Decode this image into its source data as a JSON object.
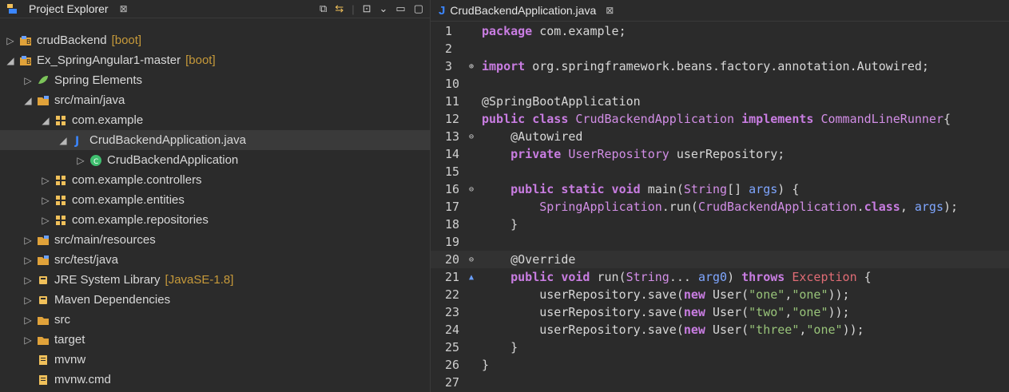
{
  "explorer": {
    "title": "Project Explorer",
    "close": "⊠",
    "items": [
      {
        "indent": 1,
        "toggle": "▷",
        "icon": "project-boot",
        "label": "crudBackend",
        "deco": "[boot]"
      },
      {
        "indent": 1,
        "toggle": "◢",
        "icon": "project-boot",
        "label": "Ex_SpringAngular1-master",
        "deco": "[boot]"
      },
      {
        "indent": 2,
        "toggle": "▷",
        "icon": "spring-leaf",
        "label": "Spring Elements",
        "deco": ""
      },
      {
        "indent": 2,
        "toggle": "◢",
        "icon": "source-folder",
        "label": "src/main/java",
        "deco": ""
      },
      {
        "indent": 3,
        "toggle": "◢",
        "icon": "package",
        "label": "com.example",
        "deco": ""
      },
      {
        "indent": 4,
        "toggle": "◢",
        "icon": "java-file",
        "label": "CrudBackendApplication.java",
        "deco": "",
        "selected": true
      },
      {
        "indent": 5,
        "toggle": "▷",
        "icon": "class",
        "label": "CrudBackendApplication",
        "deco": ""
      },
      {
        "indent": 3,
        "toggle": "▷",
        "icon": "package",
        "label": "com.example.controllers",
        "deco": ""
      },
      {
        "indent": 3,
        "toggle": "▷",
        "icon": "package",
        "label": "com.example.entities",
        "deco": ""
      },
      {
        "indent": 3,
        "toggle": "▷",
        "icon": "package",
        "label": "com.example.repositories",
        "deco": ""
      },
      {
        "indent": 2,
        "toggle": "▷",
        "icon": "source-folder",
        "label": "src/main/resources",
        "deco": ""
      },
      {
        "indent": 2,
        "toggle": "▷",
        "icon": "source-folder",
        "label": "src/test/java",
        "deco": ""
      },
      {
        "indent": 2,
        "toggle": "▷",
        "icon": "library",
        "label": "JRE System Library",
        "deco": "[JavaSE-1.8]"
      },
      {
        "indent": 2,
        "toggle": "▷",
        "icon": "library",
        "label": "Maven Dependencies",
        "deco": ""
      },
      {
        "indent": 2,
        "toggle": "▷",
        "icon": "folder",
        "label": "src",
        "deco": ""
      },
      {
        "indent": 2,
        "toggle": "▷",
        "icon": "folder",
        "label": "target",
        "deco": ""
      },
      {
        "indent": 2,
        "toggle": "",
        "icon": "file",
        "label": "mvnw",
        "deco": ""
      },
      {
        "indent": 2,
        "toggle": "",
        "icon": "file",
        "label": "mvnw.cmd",
        "deco": ""
      }
    ]
  },
  "editor": {
    "tab": {
      "label": "CrudBackendApplication.java",
      "close": "⊠"
    },
    "lines": [
      {
        "n": "1",
        "m": "",
        "segments": [
          {
            "t": "package",
            "c": "kw"
          },
          {
            "t": " com.example;",
            "c": "plain"
          }
        ]
      },
      {
        "n": "2",
        "m": "",
        "segments": []
      },
      {
        "n": "3",
        "m": "⊕",
        "segments": [
          {
            "t": "import",
            "c": "kw"
          },
          {
            "t": " org.springframework.beans.factory.annotation.Autowired;",
            "c": "plain"
          }
        ]
      },
      {
        "n": "10",
        "m": "",
        "segments": []
      },
      {
        "n": "11",
        "m": "",
        "segments": [
          {
            "t": "@SpringBootApplication",
            "c": "ann"
          }
        ]
      },
      {
        "n": "12",
        "m": "",
        "segments": [
          {
            "t": "public class ",
            "c": "kw"
          },
          {
            "t": "CrudBackendApplication",
            "c": "cls"
          },
          {
            "t": " implements ",
            "c": "kw"
          },
          {
            "t": "CommandLineRunner",
            "c": "cls"
          },
          {
            "t": "{",
            "c": "plain"
          }
        ]
      },
      {
        "n": "13",
        "m": "⊖",
        "segments": [
          {
            "t": "    @Autowired",
            "c": "ann"
          }
        ]
      },
      {
        "n": "14",
        "m": "",
        "segments": [
          {
            "t": "    private ",
            "c": "kw"
          },
          {
            "t": "UserRepository",
            "c": "cls"
          },
          {
            "t": " userRepository;",
            "c": "plain"
          }
        ]
      },
      {
        "n": "15",
        "m": "",
        "segments": []
      },
      {
        "n": "16",
        "m": "⊖",
        "segments": [
          {
            "t": "    public static void ",
            "c": "kw"
          },
          {
            "t": "main(",
            "c": "plain"
          },
          {
            "t": "String",
            "c": "cls"
          },
          {
            "t": "[] ",
            "c": "plain"
          },
          {
            "t": "args",
            "c": "pname"
          },
          {
            "t": ") {",
            "c": "plain"
          }
        ]
      },
      {
        "n": "17",
        "m": "",
        "segments": [
          {
            "t": "        ",
            "c": "plain"
          },
          {
            "t": "SpringApplication",
            "c": "cls"
          },
          {
            "t": ".run(",
            "c": "plain"
          },
          {
            "t": "CrudBackendApplication",
            "c": "cls"
          },
          {
            "t": ".",
            "c": "plain"
          },
          {
            "t": "class",
            "c": "kw"
          },
          {
            "t": ", ",
            "c": "plain"
          },
          {
            "t": "args",
            "c": "pname"
          },
          {
            "t": ");",
            "c": "plain"
          }
        ]
      },
      {
        "n": "18",
        "m": "",
        "segments": [
          {
            "t": "    }",
            "c": "plain"
          }
        ]
      },
      {
        "n": "19",
        "m": "",
        "segments": []
      },
      {
        "n": "20",
        "m": "⊖",
        "segments": [
          {
            "t": "    @Override",
            "c": "ann"
          }
        ],
        "current": true
      },
      {
        "n": "21",
        "m": "▲",
        "segments": [
          {
            "t": "    public void ",
            "c": "kw"
          },
          {
            "t": "run(",
            "c": "plain"
          },
          {
            "t": "String",
            "c": "cls"
          },
          {
            "t": "... ",
            "c": "plain"
          },
          {
            "t": "arg0",
            "c": "pname"
          },
          {
            "t": ") ",
            "c": "plain"
          },
          {
            "t": "throws ",
            "c": "kw"
          },
          {
            "t": "Exception",
            "c": "red"
          },
          {
            "t": " {",
            "c": "plain"
          }
        ]
      },
      {
        "n": "22",
        "m": "",
        "segments": [
          {
            "t": "        userRepository.save(",
            "c": "plain"
          },
          {
            "t": "new ",
            "c": "kw"
          },
          {
            "t": "User(",
            "c": "plain"
          },
          {
            "t": "\"one\"",
            "c": "str"
          },
          {
            "t": ",",
            "c": "plain"
          },
          {
            "t": "\"one\"",
            "c": "str"
          },
          {
            "t": "));",
            "c": "plain"
          }
        ]
      },
      {
        "n": "23",
        "m": "",
        "segments": [
          {
            "t": "        userRepository.save(",
            "c": "plain"
          },
          {
            "t": "new ",
            "c": "kw"
          },
          {
            "t": "User(",
            "c": "plain"
          },
          {
            "t": "\"two\"",
            "c": "str"
          },
          {
            "t": ",",
            "c": "plain"
          },
          {
            "t": "\"one\"",
            "c": "str"
          },
          {
            "t": "));",
            "c": "plain"
          }
        ]
      },
      {
        "n": "24",
        "m": "",
        "segments": [
          {
            "t": "        userRepository.save(",
            "c": "plain"
          },
          {
            "t": "new ",
            "c": "kw"
          },
          {
            "t": "User(",
            "c": "plain"
          },
          {
            "t": "\"three\"",
            "c": "str"
          },
          {
            "t": ",",
            "c": "plain"
          },
          {
            "t": "\"one\"",
            "c": "str"
          },
          {
            "t": "));",
            "c": "plain"
          }
        ]
      },
      {
        "n": "25",
        "m": "",
        "segments": [
          {
            "t": "    }",
            "c": "plain"
          }
        ]
      },
      {
        "n": "26",
        "m": "",
        "segments": [
          {
            "t": "}",
            "c": "plain"
          }
        ]
      },
      {
        "n": "27",
        "m": "",
        "segments": []
      }
    ]
  },
  "colors": {
    "background": "#2b2b2b",
    "keyword": "#c97de2",
    "string": "#98c379",
    "param": "#7fa6ff",
    "deco": "#c79a3a",
    "java_icon": "#3b86ff"
  }
}
